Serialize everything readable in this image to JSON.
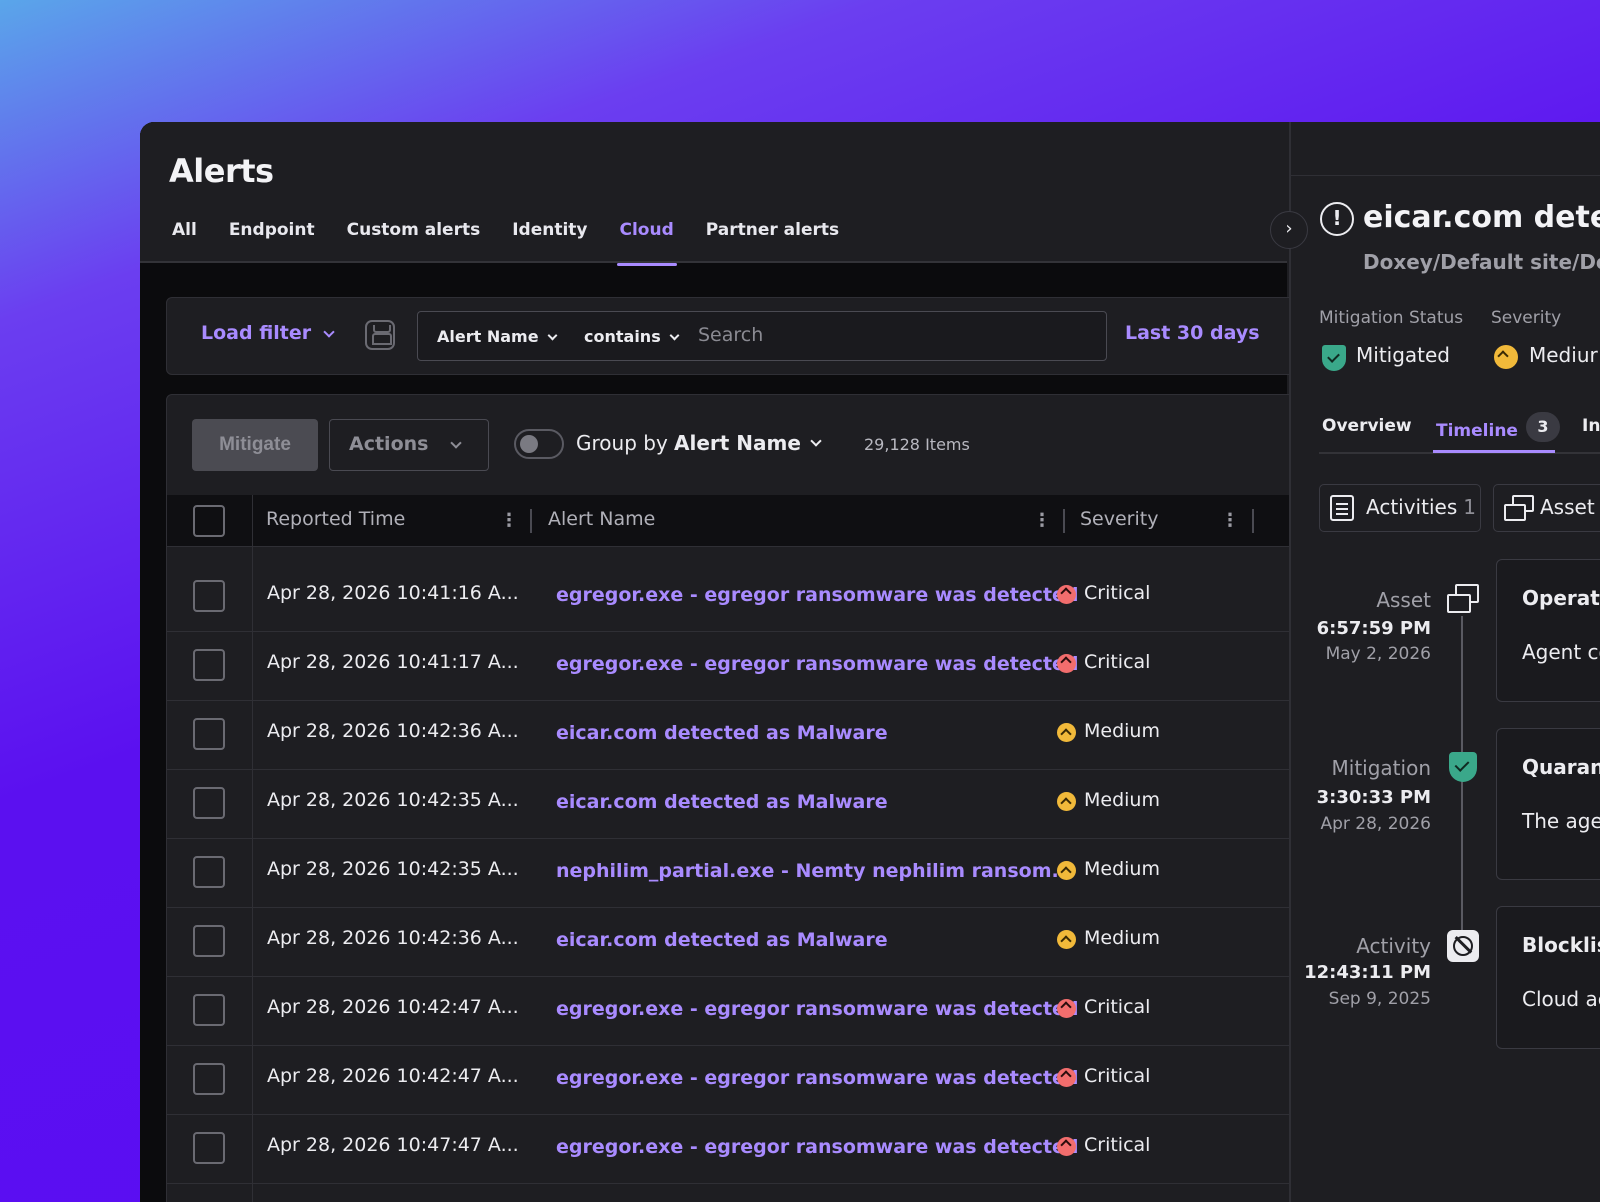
{
  "header": {
    "title": "Alerts"
  },
  "tabs": [
    {
      "label": "All",
      "active": false
    },
    {
      "label": "Endpoint",
      "active": false
    },
    {
      "label": "Custom alerts",
      "active": false
    },
    {
      "label": "Identity",
      "active": false
    },
    {
      "label": "Cloud",
      "active": true
    },
    {
      "label": "Partner alerts",
      "active": false
    }
  ],
  "filter": {
    "load_filter": "Load filter",
    "field": "Alert Name",
    "operator": "contains",
    "search_placeholder": "Search",
    "date_range": "Last 30 days"
  },
  "toolbar": {
    "mitigate": "Mitigate",
    "actions": "Actions",
    "group_by_label": "Group by",
    "group_by_value": "Alert Name",
    "items_count": "29,128 Items"
  },
  "table": {
    "columns": [
      "Reported Time",
      "Alert Name",
      "Severity"
    ],
    "rows": [
      {
        "time": "Apr 28, 2026 10:41:16 A...",
        "name": "egregor.exe - egregor ransomware was detected",
        "severity": "Critical"
      },
      {
        "time": "Apr 28, 2026 10:41:17 A...",
        "name": "egregor.exe - egregor ransomware was detected",
        "severity": "Critical"
      },
      {
        "time": "Apr 28, 2026 10:42:36 A...",
        "name": "eicar.com detected as Malware",
        "severity": "Medium"
      },
      {
        "time": "Apr 28, 2026 10:42:35 A...",
        "name": "eicar.com detected as Malware",
        "severity": "Medium"
      },
      {
        "time": "Apr 28, 2026 10:42:35 A...",
        "name": "nephilim_partial.exe - Nemty nephilim ransom...",
        "severity": "Medium"
      },
      {
        "time": "Apr 28, 2026 10:42:36 A...",
        "name": "eicar.com detected as Malware",
        "severity": "Medium"
      },
      {
        "time": "Apr 28, 2026 10:42:47 A...",
        "name": "egregor.exe - egregor ransomware was detected",
        "severity": "Critical"
      },
      {
        "time": "Apr 28, 2026 10:42:47 A...",
        "name": "egregor.exe - egregor ransomware was detected",
        "severity": "Critical"
      },
      {
        "time": "Apr 28, 2026 10:47:47 A...",
        "name": "egregor.exe - egregor ransomware was detected",
        "severity": "Critical"
      }
    ]
  },
  "detail": {
    "title": "eicar.com detecte",
    "path": "Doxey/Default site/Defa",
    "mitigation_status_label": "Mitigation Status",
    "mitigation_status_value": "Mitigated",
    "severity_label": "Severity",
    "severity_value": "Mediur",
    "tabs": [
      {
        "label": "Overview"
      },
      {
        "label": "Timeline",
        "count": "3"
      },
      {
        "label": "In"
      }
    ],
    "filters": [
      {
        "label": "Activities",
        "count": "1"
      },
      {
        "label": "Asset"
      }
    ],
    "timeline": [
      {
        "type": "Asset",
        "time": "6:57:59 PM",
        "date": "May 2, 2026",
        "card_title": "Operati",
        "card_body": "Agent co",
        "icon": "asset-icon"
      },
      {
        "type": "Mitigation",
        "time": "3:30:33 PM",
        "date": "Apr 28, 2026",
        "card_title": "Quarant",
        "card_body": "The agen",
        "icon": "shield-check-icon"
      },
      {
        "type": "Activity",
        "time": "12:43:11 PM",
        "date": "Sep 9, 2025",
        "card_title": "Blocklis",
        "card_body": "Cloud ac",
        "icon": "block-icon"
      }
    ]
  },
  "colors": {
    "accent": "#a98bff",
    "critical": "#f26d6d",
    "medium": "#f1b93a",
    "mitigated": "#3aa88a"
  }
}
